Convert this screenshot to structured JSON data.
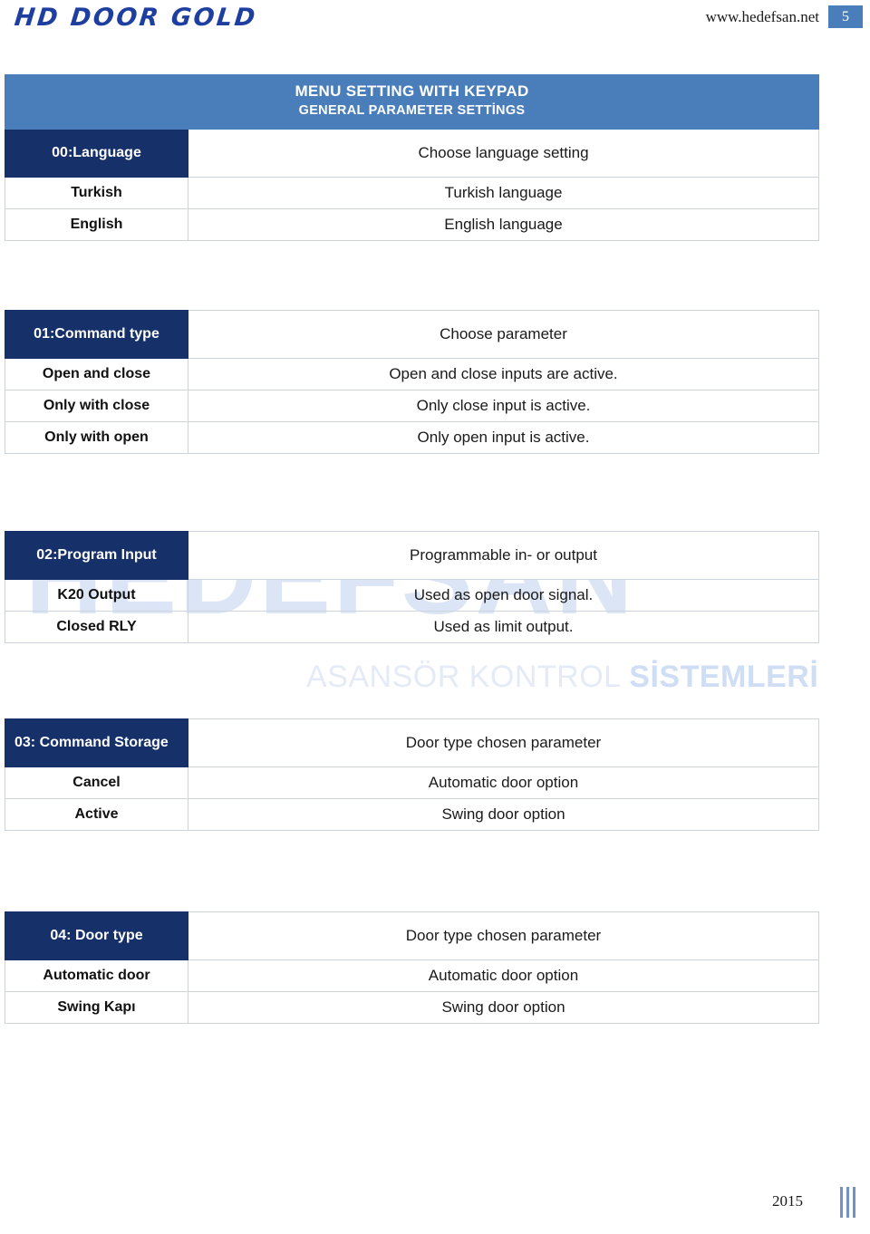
{
  "header": {
    "logo_text": "HD DOOR GOLD",
    "site_url": "www.hedefsan.net",
    "page_number": "5"
  },
  "watermark": {
    "main": "HEDEFSAN",
    "sub_light": "ASANSÖR KONTROL ",
    "sub_bold": "SİSTEMLERİ"
  },
  "banner": {
    "line1": "MENU SETTING WITH KEYPAD",
    "line2": "GENERAL PARAMETER SETTİNGS"
  },
  "tables": [
    {
      "id": "language",
      "head_key": "00:Language",
      "head_desc": "Choose language setting",
      "rows": [
        {
          "key": "Turkish",
          "desc": "Turkish language"
        },
        {
          "key": "English",
          "desc": "English language"
        }
      ]
    },
    {
      "id": "command-type",
      "head_key": "01:Command type",
      "head_desc": "Choose parameter",
      "rows": [
        {
          "key": "Open and close",
          "desc": "Open and close inputs are active."
        },
        {
          "key": "Only with close",
          "desc": "Only close input is active."
        },
        {
          "key": "Only with open",
          "desc": "Only open input is active."
        }
      ]
    },
    {
      "id": "program-input",
      "head_key": "02:Program Input",
      "head_desc": "Programmable in- or output",
      "rows": [
        {
          "key": "K20 Output",
          "desc": "Used as open door signal."
        },
        {
          "key": "Closed RLY",
          "desc": "Used as limit output."
        }
      ]
    },
    {
      "id": "command-storage",
      "head_key": "03: Command Storage",
      "head_desc": "Door type chosen parameter",
      "rows": [
        {
          "key": "Cancel",
          "desc": "Automatic door option"
        },
        {
          "key": "Active",
          "desc": "Swing door option"
        }
      ]
    },
    {
      "id": "door-type",
      "head_key": "04: Door type",
      "head_desc": "Door type chosen parameter",
      "rows": [
        {
          "key": "Automatic door",
          "desc": "Automatic door option"
        },
        {
          "key": "Swing Kapı",
          "desc": "Swing door option"
        }
      ]
    }
  ],
  "footer": {
    "year": "2015"
  },
  "colors": {
    "banner_blue": "#4a7ebb",
    "header_navy": "#16306a",
    "watermark_blue": "#dbe5f6",
    "logo_blue": "#1f3fa0"
  }
}
